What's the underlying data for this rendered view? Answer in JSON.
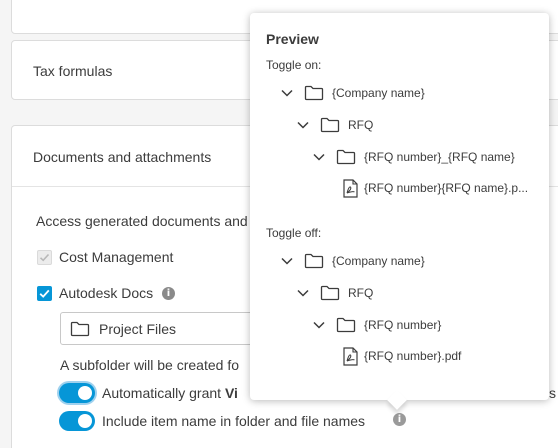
{
  "sections": {
    "tax_title": "Tax formulas",
    "docs_title": "Documents and attachments"
  },
  "docs": {
    "access_text": "Access generated documents and",
    "cost_management_label": "Cost Management",
    "autodesk_docs_label": "Autodesk Docs",
    "folder_value": "Project Files",
    "subfolder_text": "A subfolder will be created fo",
    "auto_grant_label": "Automatically grant ",
    "auto_grant_bold": "Vi",
    "auto_grant_trailing": "s",
    "include_name_label": "Include item name in folder and file names"
  },
  "preview": {
    "title": "Preview",
    "toggle_on_label": "Toggle on:",
    "toggle_off_label": "Toggle off:",
    "on_tree": [
      "{Company name}",
      "RFQ",
      "{RFQ number}_{RFQ name}",
      "{RFQ number}{RFQ name}.p..."
    ],
    "off_tree": [
      "{Company name}",
      "RFQ",
      "{RFQ number}",
      "{RFQ number}.pdf"
    ]
  },
  "colors": {
    "accent": "#0696d7",
    "text": "#3c3c3c",
    "border": "#dcdcdc"
  },
  "icons": [
    "folder-icon",
    "chevron-down-icon",
    "pdf-file-icon",
    "info-icon",
    "checkmark-icon"
  ]
}
